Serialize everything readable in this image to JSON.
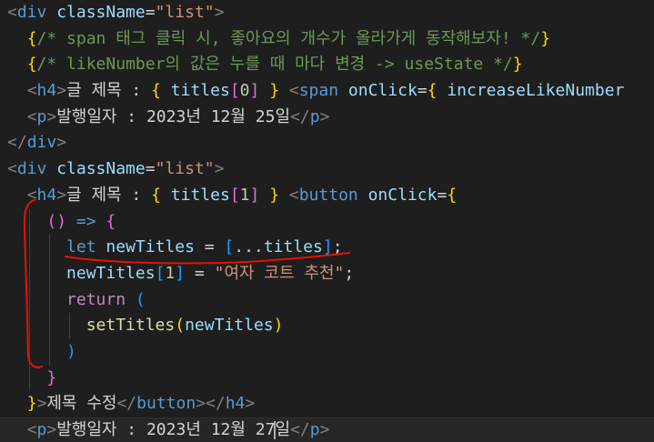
{
  "editor": {
    "lines": [
      [
        {
          "t": "<",
          "c": "tok-bracket"
        },
        {
          "t": "div",
          "c": "tok-tag"
        },
        {
          "t": " ",
          "c": "tok-text"
        },
        {
          "t": "className",
          "c": "tok-attr"
        },
        {
          "t": "=",
          "c": "tok-text"
        },
        {
          "t": "\"list\"",
          "c": "tok-str"
        },
        {
          "t": ">",
          "c": "tok-bracket"
        }
      ],
      [
        {
          "t": "  ",
          "c": "tok-text"
        },
        {
          "t": "{",
          "c": "tok-brace"
        },
        {
          "t": "/* span 태그 클릭 시, 좋아요의 개수가 올라가게 동작해보자! */",
          "c": "tok-comment"
        },
        {
          "t": "}",
          "c": "tok-brace"
        }
      ],
      [
        {
          "t": "  ",
          "c": "tok-text"
        },
        {
          "t": "{",
          "c": "tok-brace"
        },
        {
          "t": "/* likeNumber의 값은 누를 때 마다 변경 -> useState */",
          "c": "tok-comment"
        },
        {
          "t": "}",
          "c": "tok-brace"
        }
      ],
      [
        {
          "t": "  ",
          "c": "tok-text"
        },
        {
          "t": "<",
          "c": "tok-bracket"
        },
        {
          "t": "h4",
          "c": "tok-tag"
        },
        {
          "t": ">",
          "c": "tok-bracket"
        },
        {
          "t": "글 제목 : ",
          "c": "tok-text"
        },
        {
          "t": "{",
          "c": "tok-brace"
        },
        {
          "t": " ",
          "c": "tok-text"
        },
        {
          "t": "titles",
          "c": "tok-var"
        },
        {
          "t": "[",
          "c": "tok-paren"
        },
        {
          "t": "0",
          "c": "tok-num"
        },
        {
          "t": "]",
          "c": "tok-paren"
        },
        {
          "t": " ",
          "c": "tok-text"
        },
        {
          "t": "}",
          "c": "tok-brace"
        },
        {
          "t": " ",
          "c": "tok-text"
        },
        {
          "t": "<",
          "c": "tok-bracket"
        },
        {
          "t": "span",
          "c": "tok-tag"
        },
        {
          "t": " ",
          "c": "tok-text"
        },
        {
          "t": "onClick",
          "c": "tok-attr"
        },
        {
          "t": "=",
          "c": "tok-text"
        },
        {
          "t": "{",
          "c": "tok-brace"
        },
        {
          "t": " ",
          "c": "tok-text"
        },
        {
          "t": "increaseLikeNumber",
          "c": "tok-var"
        }
      ],
      [
        {
          "t": "  ",
          "c": "tok-text"
        },
        {
          "t": "<",
          "c": "tok-bracket"
        },
        {
          "t": "p",
          "c": "tok-tag"
        },
        {
          "t": ">",
          "c": "tok-bracket"
        },
        {
          "t": "발행일자 : 2023년 12월 25일",
          "c": "tok-text"
        },
        {
          "t": "</",
          "c": "tok-bracket"
        },
        {
          "t": "p",
          "c": "tok-tag"
        },
        {
          "t": ">",
          "c": "tok-bracket"
        }
      ],
      [
        {
          "t": "</",
          "c": "tok-bracket"
        },
        {
          "t": "div",
          "c": "tok-tag"
        },
        {
          "t": ">",
          "c": "tok-bracket"
        }
      ],
      [
        {
          "t": "<",
          "c": "tok-bracket"
        },
        {
          "t": "div",
          "c": "tok-tag"
        },
        {
          "t": " ",
          "c": "tok-text"
        },
        {
          "t": "className",
          "c": "tok-attr"
        },
        {
          "t": "=",
          "c": "tok-text"
        },
        {
          "t": "\"list\"",
          "c": "tok-str"
        },
        {
          "t": ">",
          "c": "tok-bracket"
        }
      ],
      [
        {
          "t": "  ",
          "c": "tok-text"
        },
        {
          "t": "<",
          "c": "tok-bracket"
        },
        {
          "t": "h4",
          "c": "tok-tag"
        },
        {
          "t": ">",
          "c": "tok-bracket"
        },
        {
          "t": "글 제목 : ",
          "c": "tok-text"
        },
        {
          "t": "{",
          "c": "tok-brace"
        },
        {
          "t": " ",
          "c": "tok-text"
        },
        {
          "t": "titles",
          "c": "tok-var"
        },
        {
          "t": "[",
          "c": "tok-paren"
        },
        {
          "t": "1",
          "c": "tok-num"
        },
        {
          "t": "]",
          "c": "tok-paren"
        },
        {
          "t": " ",
          "c": "tok-text"
        },
        {
          "t": "}",
          "c": "tok-brace"
        },
        {
          "t": " ",
          "c": "tok-text"
        },
        {
          "t": "<",
          "c": "tok-bracket"
        },
        {
          "t": "button",
          "c": "tok-tag"
        },
        {
          "t": " ",
          "c": "tok-text"
        },
        {
          "t": "onClick",
          "c": "tok-attr"
        },
        {
          "t": "=",
          "c": "tok-text"
        },
        {
          "t": "{",
          "c": "tok-brace"
        }
      ],
      [
        {
          "t": "    ",
          "c": "tok-text"
        },
        {
          "t": "(",
          "c": "tok-paren"
        },
        {
          "t": ")",
          "c": "tok-paren"
        },
        {
          "t": " ",
          "c": "tok-text"
        },
        {
          "t": "=>",
          "c": "tok-kw"
        },
        {
          "t": " ",
          "c": "tok-text"
        },
        {
          "t": "{",
          "c": "tok-paren"
        }
      ],
      [
        {
          "t": "      ",
          "c": "tok-text"
        },
        {
          "t": "let",
          "c": "tok-kw"
        },
        {
          "t": " ",
          "c": "tok-text"
        },
        {
          "t": "newTitles",
          "c": "tok-var"
        },
        {
          "t": " = ",
          "c": "tok-text"
        },
        {
          "t": "[",
          "c": "tok-brace2"
        },
        {
          "t": "...",
          "c": "tok-text"
        },
        {
          "t": "titles",
          "c": "tok-var"
        },
        {
          "t": "]",
          "c": "tok-brace2"
        },
        {
          "t": ";",
          "c": "tok-text"
        }
      ],
      [
        {
          "t": "      ",
          "c": "tok-text"
        },
        {
          "t": "newTitles",
          "c": "tok-var"
        },
        {
          "t": "[",
          "c": "tok-brace2"
        },
        {
          "t": "1",
          "c": "tok-num"
        },
        {
          "t": "]",
          "c": "tok-brace2"
        },
        {
          "t": " = ",
          "c": "tok-text"
        },
        {
          "t": "\"여자 코트 추천\"",
          "c": "tok-str"
        },
        {
          "t": ";",
          "c": "tok-text"
        }
      ],
      [
        {
          "t": "      ",
          "c": "tok-text"
        },
        {
          "t": "return",
          "c": "tok-ctrl"
        },
        {
          "t": " ",
          "c": "tok-text"
        },
        {
          "t": "(",
          "c": "tok-brace2"
        }
      ],
      [
        {
          "t": "        ",
          "c": "tok-text"
        },
        {
          "t": "setTitles",
          "c": "tok-func"
        },
        {
          "t": "(",
          "c": "tok-brace"
        },
        {
          "t": "newTitles",
          "c": "tok-var"
        },
        {
          "t": ")",
          "c": "tok-brace"
        }
      ],
      [
        {
          "t": "      ",
          "c": "tok-text"
        },
        {
          "t": ")",
          "c": "tok-brace2"
        }
      ],
      [
        {
          "t": "    ",
          "c": "tok-text"
        },
        {
          "t": "}",
          "c": "tok-paren"
        }
      ],
      [
        {
          "t": "  ",
          "c": "tok-text"
        },
        {
          "t": "}",
          "c": "tok-brace"
        },
        {
          "t": ">",
          "c": "tok-bracket"
        },
        {
          "t": "제목 수정",
          "c": "tok-text"
        },
        {
          "t": "</",
          "c": "tok-bracket"
        },
        {
          "t": "button",
          "c": "tok-tag"
        },
        {
          "t": ">",
          "c": "tok-bracket"
        },
        {
          "t": "</",
          "c": "tok-bracket"
        },
        {
          "t": "h4",
          "c": "tok-tag"
        },
        {
          "t": ">",
          "c": "tok-bracket"
        }
      ],
      [
        {
          "t": "  ",
          "c": "tok-text"
        },
        {
          "t": "<",
          "c": "tok-bracket"
        },
        {
          "t": "p",
          "c": "tok-tag"
        },
        {
          "t": ">",
          "c": "tok-bracket"
        },
        {
          "t": "발행일자 : 2023년 12월 27",
          "c": "tok-text"
        },
        {
          "t": "|cursor|",
          "c": "cursor"
        },
        {
          "t": "일",
          "c": "tok-text"
        },
        {
          "t": "</",
          "c": "tok-bracket"
        },
        {
          "t": "p",
          "c": "tok-tag"
        },
        {
          "t": ">",
          "c": "tok-bracket"
        }
      ]
    ],
    "current_line": 16,
    "annotation_color": "#e51400"
  }
}
